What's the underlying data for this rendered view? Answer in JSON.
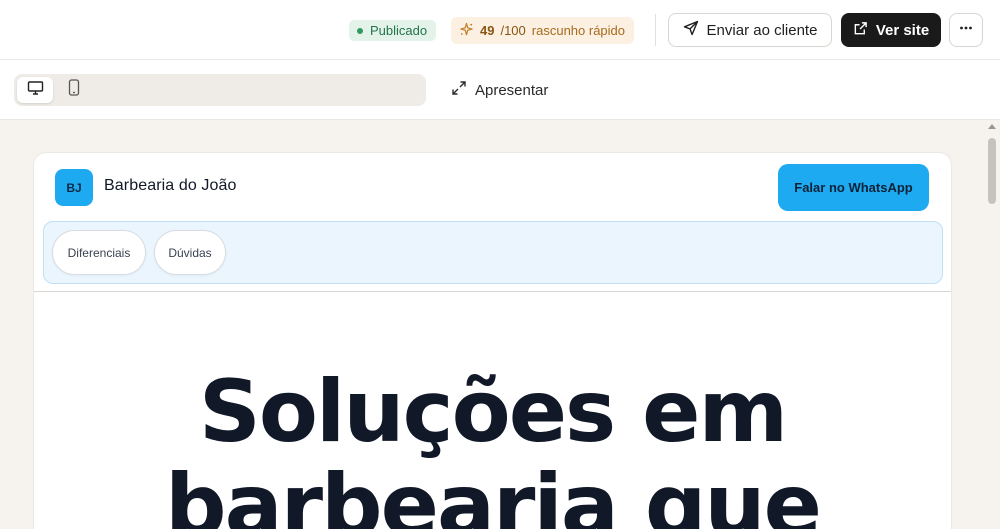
{
  "topbar": {
    "status_badge": "Publicado",
    "score_value": "49",
    "score_max": "/100",
    "score_label": "rascunho rápido",
    "send_button": "Enviar ao cliente",
    "view_site_button": "Ver site",
    "more_button": "···"
  },
  "toolbar": {
    "present_button": "Apresentar"
  },
  "preview": {
    "logo_initials": "BJ",
    "brand_name": "Barbearia do João",
    "cta_button": "Falar no WhatsApp",
    "nav_items": [
      "Diferenciais",
      "Dúvidas"
    ],
    "hero_line1": "Soluções em",
    "hero_line2": "barbearia que"
  },
  "colors": {
    "accent": "#1eaaf1",
    "published_bg": "#e4f3ea",
    "score_bg": "#fbf0e1",
    "primary_dark": "#1a1a1a"
  },
  "icons": [
    "sparkle-icon",
    "send-icon",
    "external-link-icon",
    "more-icon",
    "desktop-icon",
    "mobile-icon",
    "expand-icon"
  ]
}
